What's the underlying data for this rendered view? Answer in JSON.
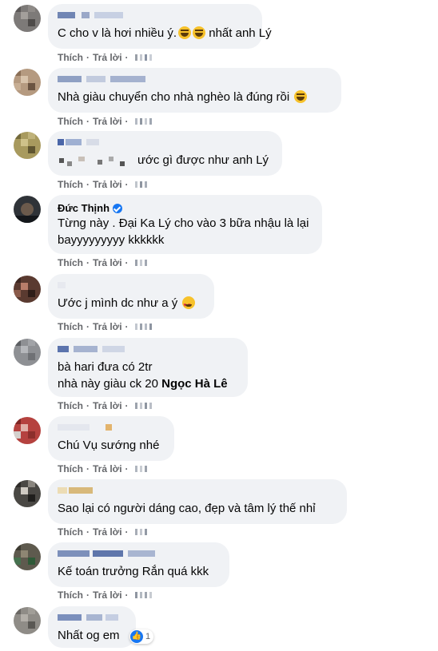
{
  "actions": {
    "like": "Thích",
    "reply": "Trả lời",
    "separator": "·"
  },
  "comments": [
    {
      "author": "",
      "text": "C cho v là hơi nhiều ý.",
      "emoji": [
        "laugh",
        "laugh"
      ],
      "text_after": " nhất anh Lý"
    },
    {
      "author": "",
      "text": "Nhà giàu chuyển cho nhà nghèo là đúng rồi",
      "emoji": [
        "laugh"
      ]
    },
    {
      "author": "",
      "text": "ước gì được như anh Lý"
    },
    {
      "author": "Đức Thịnh",
      "verified": true,
      "line1": "Từng này . Đại Ka Lý cho vào 3 bữa nhậu là lại",
      "line2": "bayyyyyyyyy kkkkkk"
    },
    {
      "author": "",
      "text": "Ước j mình dc như a ý",
      "emoji": [
        "heart-eyes"
      ]
    },
    {
      "author": "",
      "line1": "bà hari đưa có 2tr",
      "line2": "nhà này giàu ck 20",
      "mention": "Ngọc Hà Lê"
    },
    {
      "author": "",
      "text": "Chú Vụ sướng nhé"
    },
    {
      "author": "",
      "text": "Sao lại có người dáng cao, đẹp và tâm lý thế nhỉ"
    },
    {
      "author": "",
      "text": "Kế toán trưởng Rắn quá kkk"
    },
    {
      "author": "",
      "text": "Nhất og em",
      "reactions": {
        "icon": "like-icon",
        "count": "1"
      }
    }
  ],
  "colors": {
    "bubble": "#f0f2f5",
    "action_text": "#65676b",
    "like_blue": "#1877f2"
  }
}
